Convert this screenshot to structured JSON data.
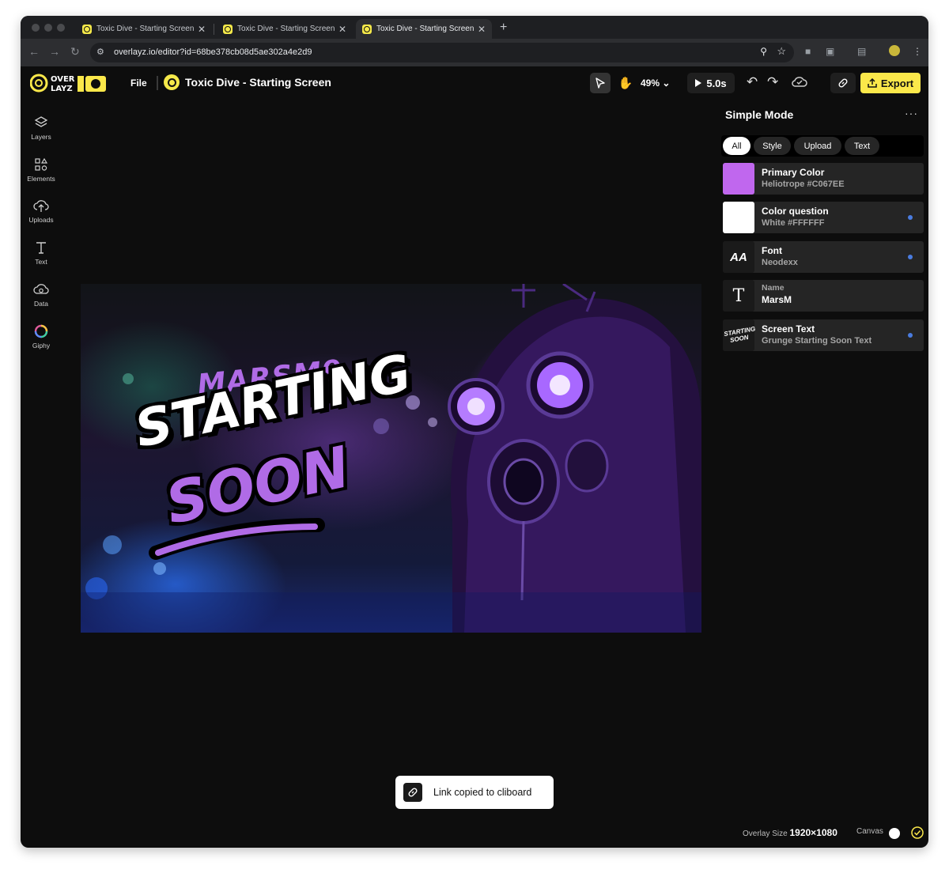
{
  "browser": {
    "tabs": [
      {
        "title": "Toxic Dive - Starting Screen -",
        "close": "✕"
      },
      {
        "title": "Toxic Dive - Starting Screen -",
        "close": "✕"
      },
      {
        "title": "Toxic Dive - Starting Screen -",
        "close": "✕"
      }
    ],
    "new_tab": "+",
    "url": "overlayz.io/editor?id=68be378cb08d5ae302a4e2d9"
  },
  "header": {
    "logo_text": "OVERLAYZ iO",
    "file_menu": "File",
    "project_title": "Toxic Dive - Starting Screen",
    "zoom": "49%",
    "duration": "5.0s",
    "export_label": "Export"
  },
  "sidebar": {
    "items": [
      {
        "label": "Layers",
        "icon": "layers-icon"
      },
      {
        "label": "Elements",
        "icon": "shapes-icon"
      },
      {
        "label": "Uploads",
        "icon": "cloud-upload-icon"
      },
      {
        "label": "Text",
        "icon": "text-icon"
      },
      {
        "label": "Data",
        "icon": "data-icon"
      },
      {
        "label": "Giphy",
        "icon": "giphy-icon"
      }
    ]
  },
  "canvas": {
    "name_text": "MARSM9",
    "line1": "STARTING",
    "line2": "SOON"
  },
  "panel": {
    "title": "Simple Mode",
    "more": "···",
    "filters": [
      "All",
      "Style",
      "Upload",
      "Text"
    ],
    "active_filter": "All",
    "properties": [
      {
        "title": "Primary Color",
        "subtitle": "Heliotrope #C067EE",
        "swatch": "#C067EE"
      },
      {
        "title": "Color question",
        "subtitle": "White #FFFFFF",
        "swatch": "#FFFFFF"
      },
      {
        "title": "Font",
        "subtitle": "Neodexx",
        "preview": "AA"
      },
      {
        "title": "Name",
        "subtitle": "MarsM",
        "preview": "T"
      },
      {
        "title": "Screen Text",
        "subtitle": "Grunge Starting Soon Text",
        "preview": "STARTING SOON"
      }
    ]
  },
  "toast": {
    "message": "Link copied to cliboard"
  },
  "status": {
    "overlay_size_label": "Overlay Size",
    "overlay_size_value": "1920×1080",
    "canvas_label": "Canvas"
  },
  "colors": {
    "accent": "#FBE84A",
    "primary": "#C067EE",
    "indicator": "#4A7CE0"
  }
}
